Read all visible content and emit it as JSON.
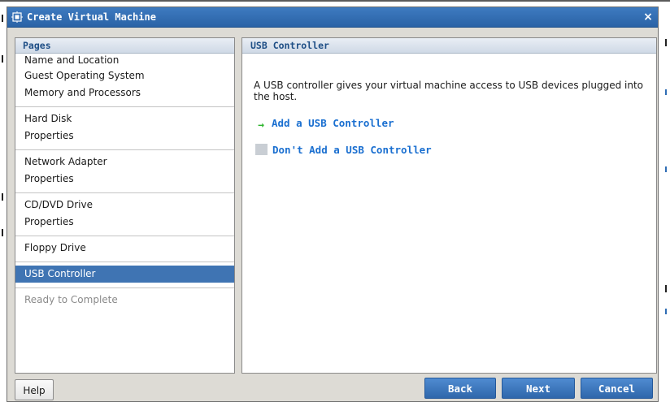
{
  "window": {
    "title": "Create Virtual Machine",
    "close_label": "×",
    "icon": "vm-wizard-icon"
  },
  "pages": {
    "header": "Pages",
    "groups": [
      {
        "items": [
          {
            "label": "Name and Location",
            "state": "normal"
          },
          {
            "label": "Guest Operating System",
            "state": "normal"
          },
          {
            "label": "Memory and Processors",
            "state": "normal"
          }
        ]
      },
      {
        "items": [
          {
            "label": "Hard Disk",
            "state": "normal"
          },
          {
            "label": "Properties",
            "state": "normal"
          }
        ]
      },
      {
        "items": [
          {
            "label": "Network Adapter",
            "state": "normal"
          },
          {
            "label": "Properties",
            "state": "normal"
          }
        ]
      },
      {
        "items": [
          {
            "label": "CD/DVD Drive",
            "state": "normal"
          },
          {
            "label": "Properties",
            "state": "normal"
          }
        ]
      },
      {
        "items": [
          {
            "label": "Floppy Drive",
            "state": "normal"
          }
        ]
      },
      {
        "items": [
          {
            "label": "USB Controller",
            "state": "selected"
          }
        ]
      },
      {
        "items": [
          {
            "label": "Ready to Complete",
            "state": "disabled"
          }
        ]
      }
    ]
  },
  "content": {
    "header": "USB Controller",
    "description": "A USB controller gives your virtual machine access to USB devices plugged into the host.",
    "options": [
      {
        "label": "Add a USB Controller",
        "icon": "green-arrow-icon"
      },
      {
        "label": "Don't Add a USB Controller",
        "icon": "gray-box-icon"
      }
    ]
  },
  "buttons": {
    "help": "Help",
    "back": "Back",
    "next": "Next",
    "cancel": "Cancel"
  },
  "colors": {
    "title_bar": "#2f6aae",
    "selected": "#3f74b3",
    "link": "#1a6fd0",
    "arrow": "#2cb52c"
  }
}
